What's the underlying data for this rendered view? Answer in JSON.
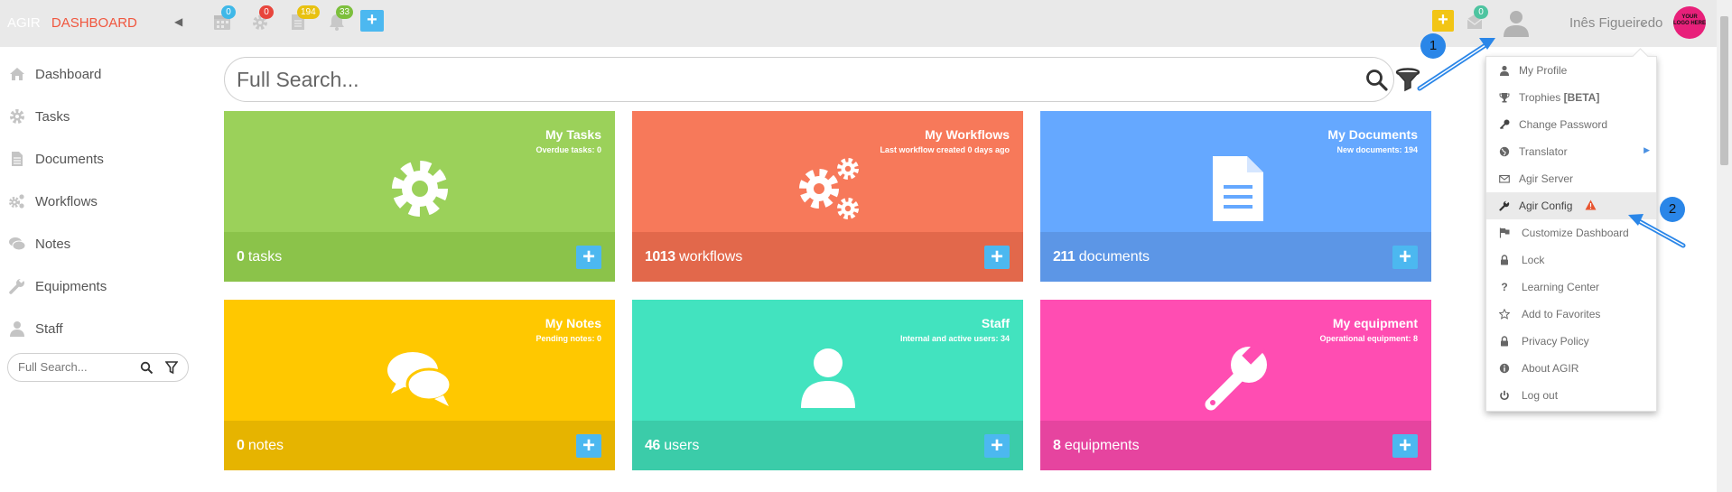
{
  "brand": {
    "app": "AGIR",
    "section": "DASHBOARD"
  },
  "topbar": {
    "badges": {
      "calendar": "0",
      "settings": "0",
      "documents": "194",
      "notifications": "33",
      "messages": "0"
    },
    "user_name": "Inês Figueiredo",
    "logo_text": "YOUR LOGO HERE"
  },
  "sidebar": {
    "items": [
      {
        "label": "Dashboard",
        "icon": "home-icon"
      },
      {
        "label": "Tasks",
        "icon": "gear-icon"
      },
      {
        "label": "Documents",
        "icon": "document-icon"
      },
      {
        "label": "Workflows",
        "icon": "gears-icon"
      },
      {
        "label": "Notes",
        "icon": "comments-icon"
      },
      {
        "label": "Equipments",
        "icon": "wrench-icon"
      },
      {
        "label": "Staff",
        "icon": "user-icon"
      }
    ],
    "search_placeholder": "Full Search..."
  },
  "main_search": {
    "placeholder": "Full Search..."
  },
  "tiles": [
    {
      "title": "My Tasks",
      "subtitle": "Overdue tasks: 0",
      "count": "0",
      "unit": "tasks",
      "color": "#9bd15a",
      "bottom": "#8bc34a",
      "icon": "gear-icon"
    },
    {
      "title": "My Workflows",
      "subtitle": "Last workflow created 0 days ago",
      "count": "1013",
      "unit": "workflows",
      "color": "#f7795a",
      "bottom": "#e2684b",
      "icon": "gears-icon"
    },
    {
      "title": "My Documents",
      "subtitle": "New documents: 194",
      "count": "211",
      "unit": "documents",
      "color": "#65a8ff",
      "bottom": "#5c96e6",
      "icon": "document-icon"
    },
    {
      "title": "My Notes",
      "subtitle": "Pending notes: 0",
      "count": "0",
      "unit": "notes",
      "color": "#ffc800",
      "bottom": "#e6b400",
      "icon": "comments-icon"
    },
    {
      "title": "Staff",
      "subtitle": "Internal and active users: 34",
      "count": "46",
      "unit": "users",
      "color": "#42e3bf",
      "bottom": "#3bcca9",
      "icon": "user-icon"
    },
    {
      "title": "My equipment",
      "subtitle": "Operational equipment: 8",
      "count": "8",
      "unit": "equipments",
      "color": "#ff4db2",
      "bottom": "#e6449f",
      "icon": "wrench-icon"
    }
  ],
  "dropdown": {
    "items": [
      {
        "label": "My Profile",
        "icon": "user-icon"
      },
      {
        "label": "Trophies ",
        "bold": "[BETA]",
        "icon": "trophy-icon"
      },
      {
        "label": "Change Password",
        "icon": "key-icon"
      },
      {
        "label": "Translator",
        "icon": "globe-icon"
      },
      {
        "label": "Agir Server",
        "icon": "envelope-icon"
      },
      {
        "label": "Agir Config",
        "icon": "wrench-icon",
        "highlighted": true
      },
      {
        "label": "Customize Dashboard",
        "icon": "flag-icon"
      },
      {
        "label": "Lock",
        "icon": "lock-icon"
      },
      {
        "label": "Learning Center",
        "icon": "question-icon"
      },
      {
        "label": "Add to Favorites",
        "icon": "star-icon"
      },
      {
        "label": "Privacy Policy",
        "icon": "lock-icon"
      },
      {
        "label": "About AGIR",
        "icon": "info-icon"
      },
      {
        "label": "Log out",
        "icon": "power-icon"
      }
    ]
  },
  "annotations": {
    "marker1": "1",
    "marker2": "2"
  }
}
